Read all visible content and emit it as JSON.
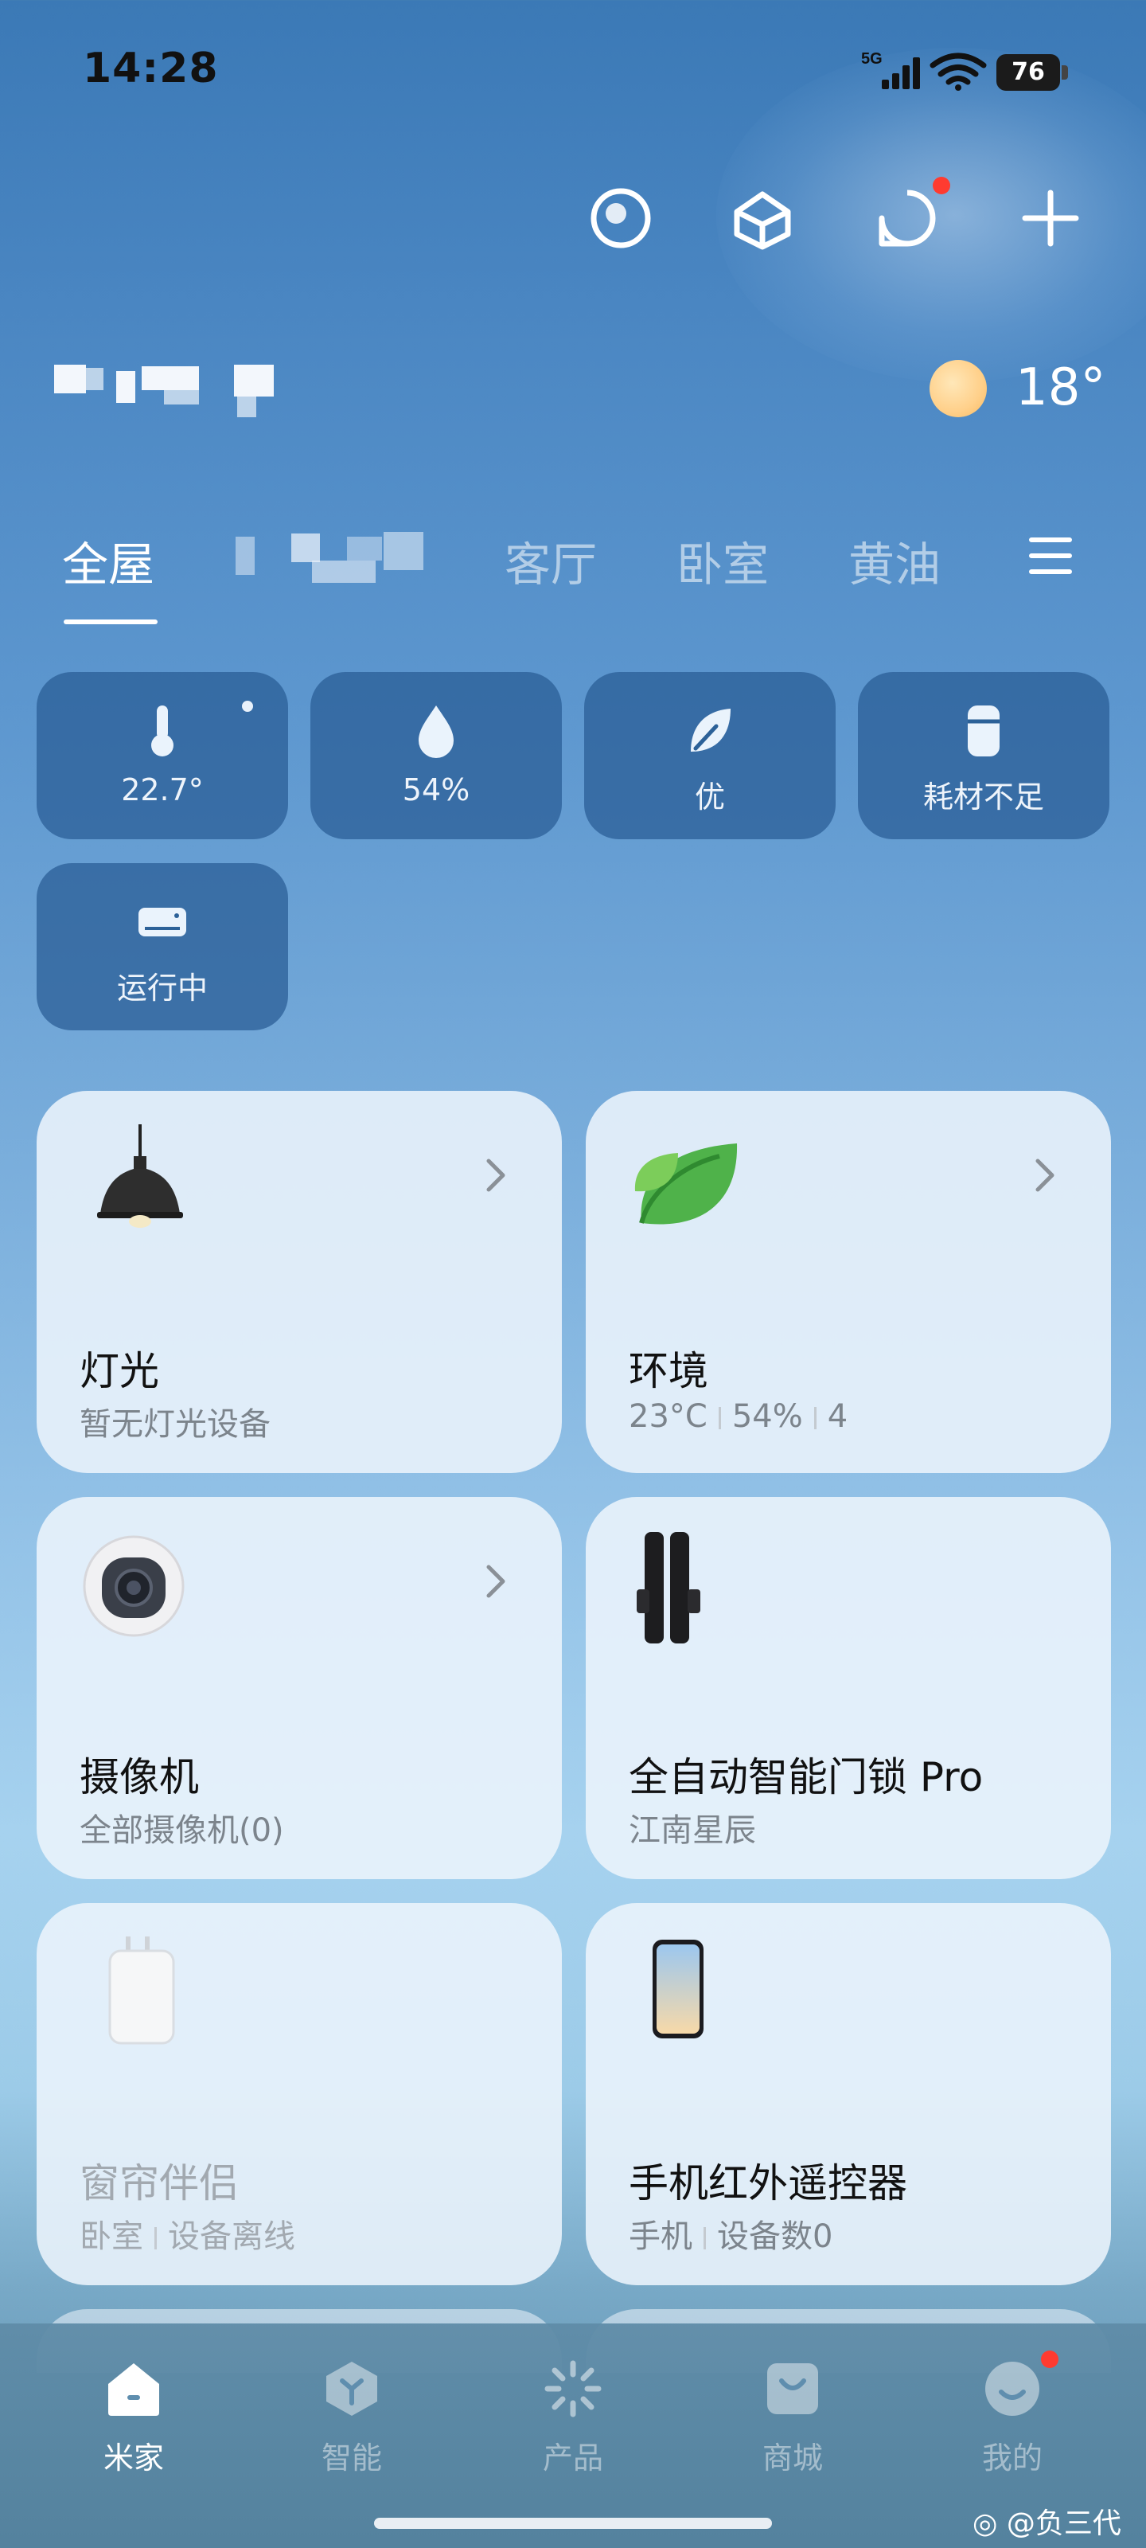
{
  "status_bar": {
    "time": "14:28",
    "network": "5G",
    "battery": "76"
  },
  "header": {
    "temperature": "18°",
    "notification_badge": true
  },
  "tabs": [
    {
      "label": "全屋",
      "active": true
    },
    {
      "label": "客厅",
      "active": false
    },
    {
      "label": "卧室",
      "active": false
    },
    {
      "label": "黄油",
      "active": false
    }
  ],
  "env_chips": [
    {
      "icon": "thermometer-icon",
      "label": "22.7°"
    },
    {
      "icon": "water-drop-icon",
      "label": "54%"
    },
    {
      "icon": "leaf-icon",
      "label": "优"
    },
    {
      "icon": "filter-cartridge-icon",
      "label": "耗材不足"
    },
    {
      "icon": "air-conditioner-icon",
      "label": "运行中"
    }
  ],
  "cards": [
    {
      "title": "灯光",
      "sub": "暂无灯光设备",
      "icon": "pendant-lamp-icon"
    },
    {
      "title": "环境",
      "sub_parts": [
        "23°C",
        "54%",
        "4"
      ],
      "icon": "leaf-icon"
    },
    {
      "title": "摄像机",
      "sub": "全部摄像机(0)",
      "icon": "camera-icon"
    },
    {
      "title": "全自动智能门锁 Pro",
      "sub": "江南星辰",
      "icon": "door-lock-icon"
    },
    {
      "title": "窗帘伴侣",
      "sub_parts": [
        "卧室",
        "设备离线"
      ],
      "icon": "curtain-companion-icon",
      "offline": true
    },
    {
      "title": "手机红外遥控器",
      "sub_parts": [
        "手机",
        "设备数0"
      ],
      "icon": "phone-remote-icon"
    }
  ],
  "bottom_nav": [
    {
      "label": "米家",
      "icon": "home-icon",
      "active": true
    },
    {
      "label": "智能",
      "icon": "smart-cube-icon",
      "active": false
    },
    {
      "label": "产品",
      "icon": "product-sparkle-icon",
      "active": false
    },
    {
      "label": "商城",
      "icon": "shopping-bag-icon",
      "active": false
    },
    {
      "label": "我的",
      "icon": "profile-face-icon",
      "active": false
    }
  ],
  "watermark": "@负三代",
  "colors": {
    "accent_red": "#ff3b30",
    "chip_bg": "#285c94",
    "card_bg": "#ecf4fc"
  }
}
